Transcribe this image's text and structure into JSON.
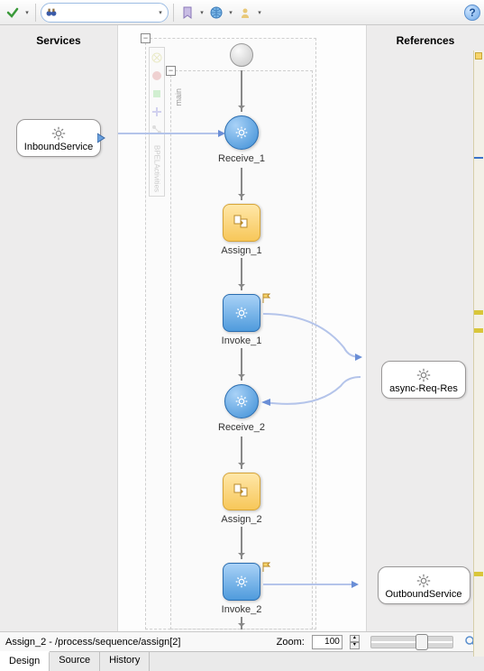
{
  "toolbar": {
    "search_placeholder": "",
    "help": "?"
  },
  "columns": {
    "services_title": "Services",
    "references_title": "References"
  },
  "partners": {
    "inbound": "InboundService",
    "async": "async-Req-Res",
    "outbound": "OutboundService"
  },
  "scope": {
    "main_label": "main"
  },
  "nodes": {
    "receive1": "Receive_1",
    "assign1": "Assign_1",
    "invoke1": "Invoke_1",
    "receive2": "Receive_2",
    "assign2": "Assign_2",
    "invoke2": "Invoke_2"
  },
  "status": {
    "path": "Assign_2 - /process/sequence/assign[2]",
    "zoom_label": "Zoom:",
    "zoom_value": "100"
  },
  "tabs": {
    "design": "Design",
    "source": "Source",
    "history": "History"
  }
}
